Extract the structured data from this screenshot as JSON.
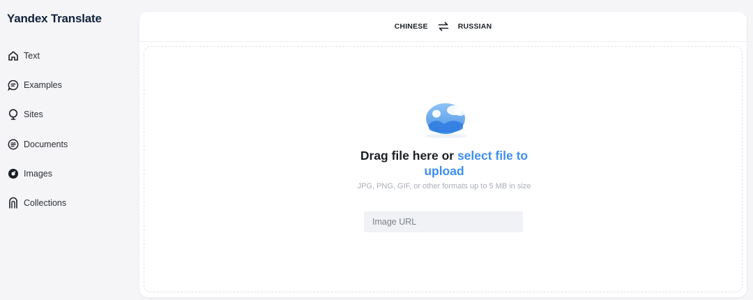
{
  "app": {
    "title": "Yandex Translate"
  },
  "sidebar": {
    "items": [
      {
        "label": "Text",
        "icon": "home-icon",
        "active": false
      },
      {
        "label": "Examples",
        "icon": "chat-bubble-icon",
        "active": false
      },
      {
        "label": "Sites",
        "icon": "globe-pin-icon",
        "active": false
      },
      {
        "label": "Documents",
        "icon": "document-icon",
        "active": false
      },
      {
        "label": "Images",
        "icon": "camera-lens-icon",
        "active": true
      },
      {
        "label": "Collections",
        "icon": "bookmark-icon",
        "active": false
      }
    ]
  },
  "languages": {
    "source": "CHINESE",
    "target": "RUSSIAN",
    "swap_icon": "swap-arrows-icon"
  },
  "upload": {
    "headline_prefix": "Drag file here or ",
    "headline_link": "select file to upload",
    "hint": "JPG, PNG, GIF, or other formats up to 5 MB in size",
    "url_placeholder": "Image URL",
    "url_value": "",
    "illustration_icon": "image-placeholder-icon"
  },
  "colors": {
    "link": "#3e8ef0",
    "background": "#f5f5f7",
    "card": "#ffffff"
  }
}
